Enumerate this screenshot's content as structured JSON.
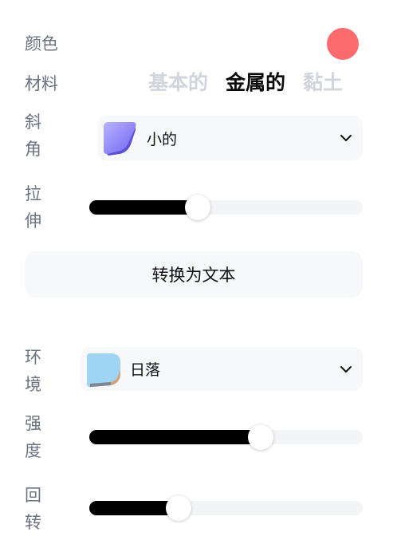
{
  "labels": {
    "color": "颜色",
    "material": "材料",
    "bevel_1": "斜",
    "bevel_2": "角",
    "stretch_1": "拉",
    "stretch_2": "伸",
    "environment_1": "环",
    "environment_2": "境",
    "intensity_1": "强",
    "intensity_2": "度",
    "rotation_1": "回",
    "rotation_2": "转"
  },
  "color_swatch": "#fb6b6e",
  "materials": {
    "basic": "基本的",
    "metal": "金属的",
    "clay": "黏土",
    "selected": "metal"
  },
  "bevel_dropdown": {
    "value": "小的",
    "icon": "bevel-small-thumbnail"
  },
  "stretch_slider": {
    "value": 0.35
  },
  "convert_button": "转换为文本",
  "environment_dropdown": {
    "value": "日落",
    "icon": "sunset-thumbnail"
  },
  "intensity_slider": {
    "value": 0.58
  },
  "rotation_slider": {
    "value": 0.28
  }
}
